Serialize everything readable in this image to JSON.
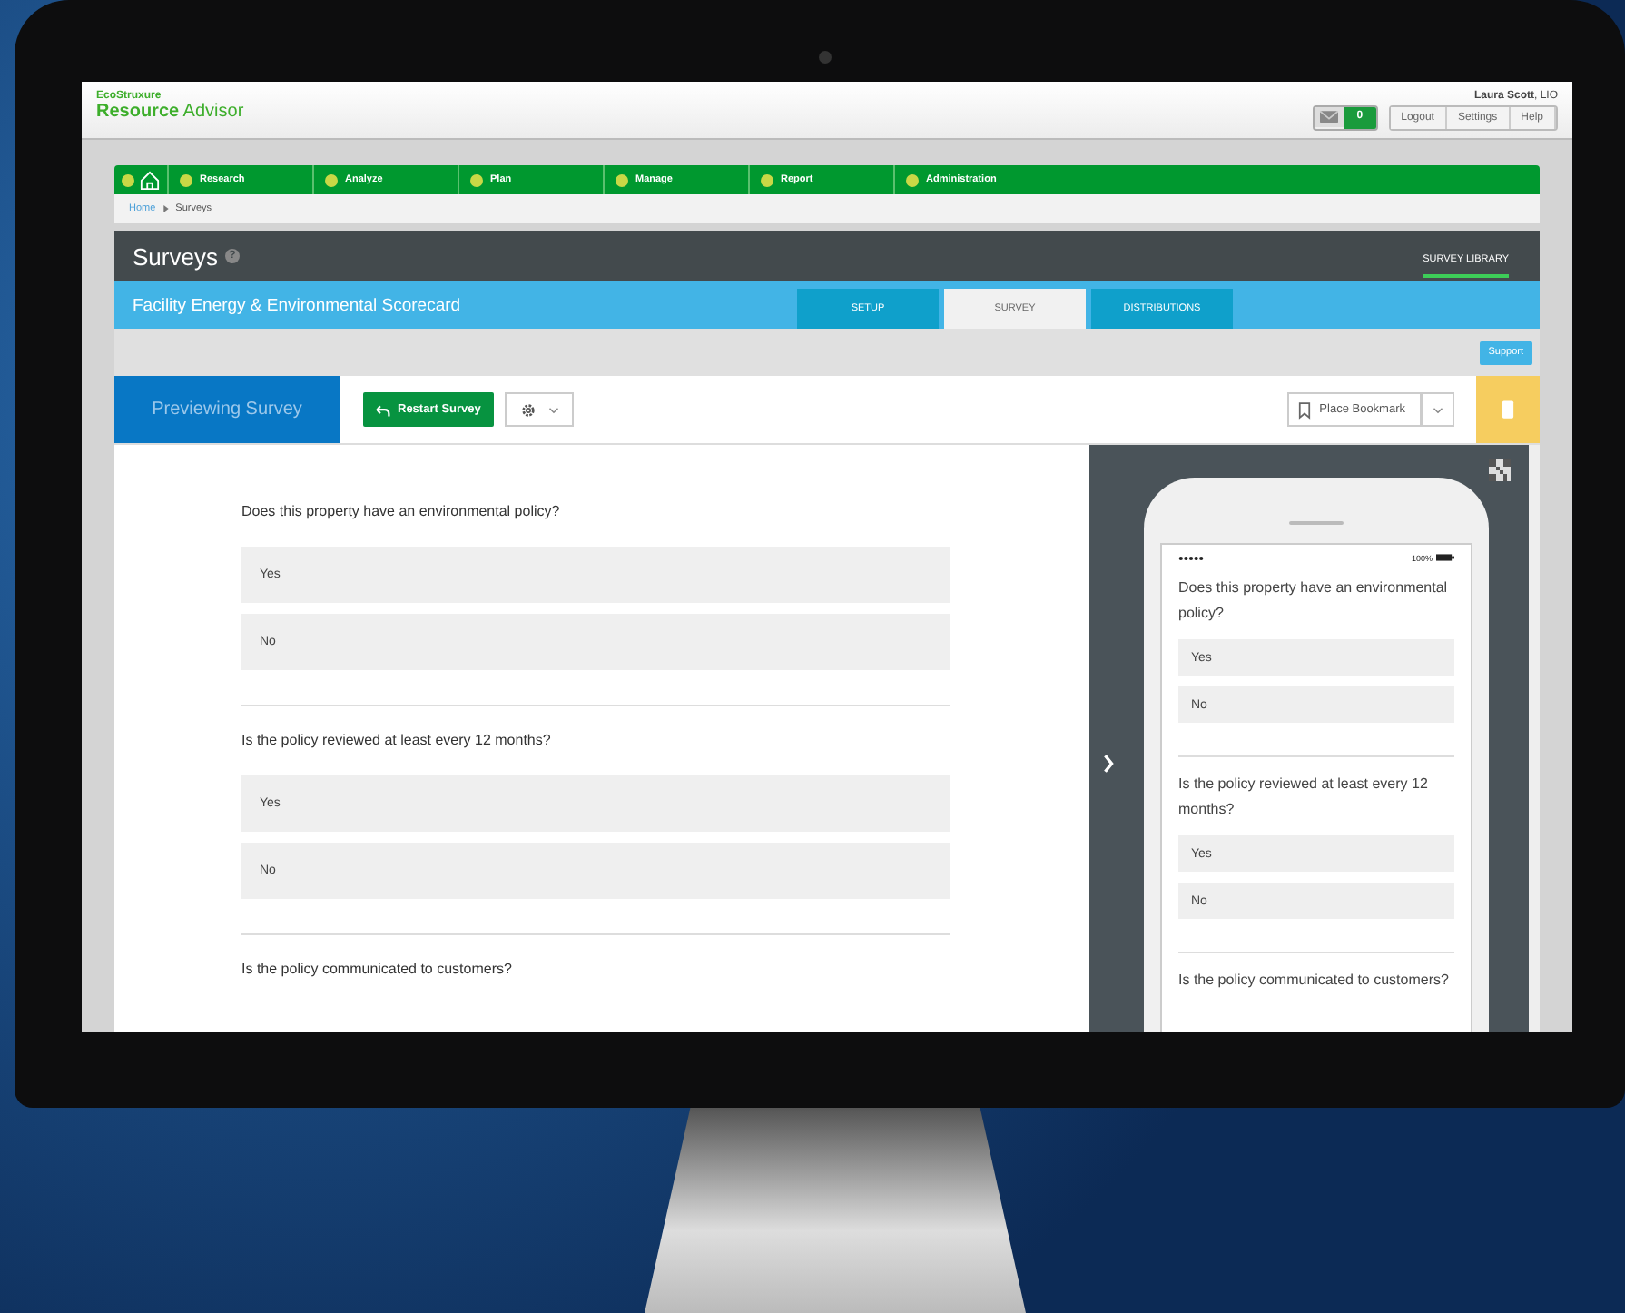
{
  "header": {
    "brand_top": "EcoStruxure",
    "brand": "**Resource** Advisor",
    "user": "**Laura Scott**, LIO",
    "message_count": "0",
    "buttons": [
      "Logout",
      "Settings",
      "Help"
    ]
  },
  "nav": [
    "Research",
    "Analyze",
    "Plan",
    "Manage",
    "Report",
    "Administration"
  ],
  "breadcrumb": [
    {
      "label": "Home",
      "link": true
    },
    {
      "label": "Surveys",
      "link": false
    }
  ],
  "section": {
    "title": "Surveys",
    "help": "?",
    "library_link": {
      "label": "SURVEY LIBRARY",
      "selected": true
    }
  },
  "survey": {
    "title": "Facility Energy & Environmental Scorecard",
    "tabs": [
      {
        "label": "SETUP",
        "selected": false
      },
      {
        "label": "SURVEY",
        "selected": true
      },
      {
        "label": "DISTRIBUTIONS",
        "selected": false
      }
    ]
  },
  "support": "Support",
  "toolbar": {
    "mode": "Previewing Survey",
    "restart": "Restart Survey",
    "bookmark": "Place Bookmark"
  },
  "questions": [
    {
      "text": "Does this property have an environmental policy?",
      "options": [
        "Yes",
        "No"
      ]
    },
    {
      "text": "Is the policy reviewed at least every 12 months?",
      "options": [
        "Yes",
        "No"
      ]
    },
    {
      "text": "Is the policy communicated to customers?"
    }
  ],
  "phone": {
    "battery": "100%",
    "questions": [
      {
        "text": "Does this property have an environmental policy?",
        "options": [
          "Yes",
          "No"
        ]
      },
      {
        "text": "Is the policy reviewed at least every 12 months?",
        "options": [
          "Yes",
          "No"
        ]
      },
      {
        "text": "Is the policy communicated to customers?"
      }
    ]
  }
}
